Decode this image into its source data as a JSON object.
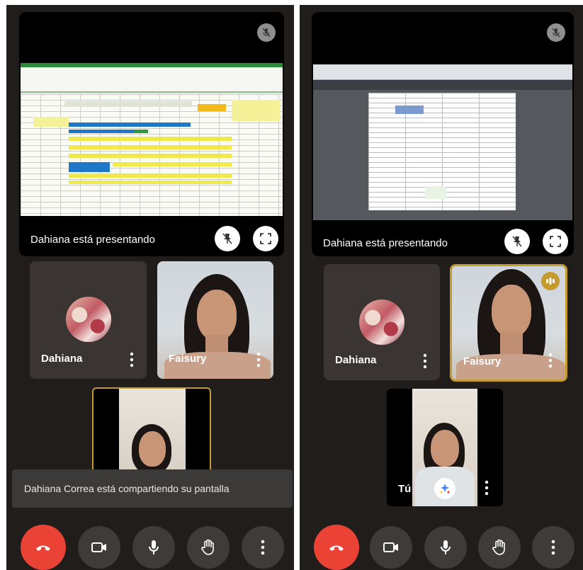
{
  "left": {
    "presenting_caption": "Dahiana está presentando",
    "participants": [
      {
        "name": "Dahiana"
      },
      {
        "name": "Faisury"
      }
    ],
    "toast": "Dahiana Correa está compartiendo su pantalla"
  },
  "right": {
    "presenting_caption": "Dahiana está presentando",
    "participants": [
      {
        "name": "Dahiana"
      },
      {
        "name": "Faisury"
      }
    ],
    "self_name": "Tú"
  },
  "colors": {
    "background": "#201d1b",
    "tile": "#3a3532",
    "end_call": "#ea4335",
    "speaking_border": "#c59a2e"
  },
  "icons": [
    "mic-off-icon",
    "pin-off-icon",
    "fullscreen-icon",
    "more-vert-icon",
    "end-call-icon",
    "camera-icon",
    "mic-icon",
    "hand-icon",
    "effects-icon",
    "speaking-icon"
  ]
}
